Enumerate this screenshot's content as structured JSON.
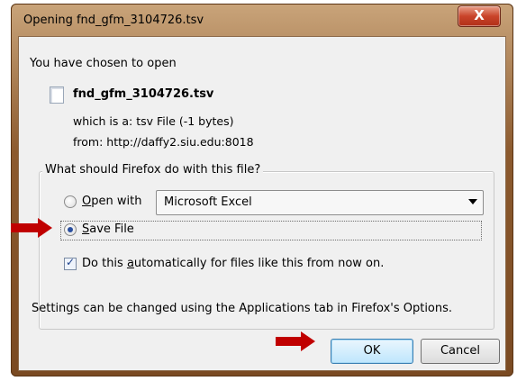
{
  "window": {
    "title": "Opening fnd_gfm_3104726.tsv",
    "close_label": "X"
  },
  "intro": "You have chosen to open",
  "file": {
    "name": "fnd_gfm_3104726.tsv",
    "which_is": "which is a:  tsv File (-1 bytes)",
    "from": "from:  http://daffy2.siu.edu:8018"
  },
  "group": {
    "title": "What should Firefox do with this file?",
    "open_with": {
      "accesskey": "O",
      "rest": "pen with",
      "selected": false
    },
    "application": "Microsoft Excel",
    "save_file": {
      "accesskey": "S",
      "rest": "ave File",
      "selected": true
    },
    "auto": {
      "before": "Do this ",
      "accesskey": "a",
      "rest": "utomatically for files like this from now on.",
      "checked": true
    },
    "settings_note": "Settings can be changed using the Applications tab in Firefox's Options."
  },
  "buttons": {
    "ok": "OK",
    "cancel": "Cancel"
  },
  "colors": {
    "annotation_arrow": "#c00000",
    "frame": "#8c5a2e",
    "close": "#c9442a"
  }
}
